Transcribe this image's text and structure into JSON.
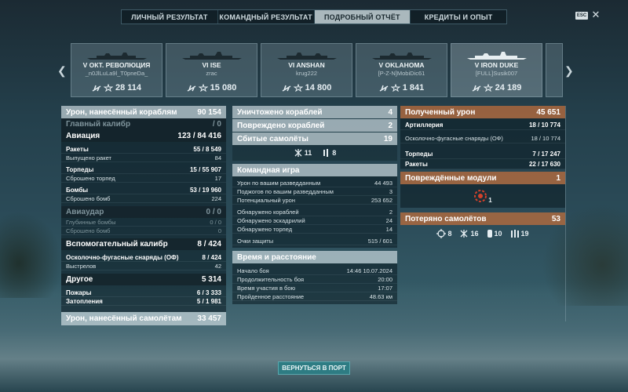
{
  "tabs": [
    "ЛИЧНЫЙ РЕЗУЛЬТАТ",
    "КОМАНДНЫЙ РЕЗУЛЬТАТ",
    "ПОДРОБНЫЙ ОТЧЁТ",
    "КРЕДИТЫ И ОПЫТ"
  ],
  "active_tab": "ПОДРОБНЫЙ ОТЧЁТ",
  "esc_label": "ESC",
  "close_glyph": "✕",
  "arrows": {
    "left": "❮",
    "right": "❯"
  },
  "ships": [
    {
      "name": "V  ОКТ. РЕВОЛЮЦИЯ",
      "player": "_n0JlLuLa9l_T0pneDa_",
      "frags": "",
      "damage": "28 114"
    },
    {
      "name": "VI  ISE",
      "player": "zrac",
      "frags": "",
      "damage": "15 080"
    },
    {
      "name": "VI  ANSHAN",
      "player": "krug222",
      "frags": "",
      "damage": "14 800"
    },
    {
      "name": "V  OKLAHOMA",
      "player": "[P-Z-N]MobiDic61",
      "frags": "",
      "damage": "1 841"
    },
    {
      "name": "V  IRON DUKE",
      "player": "[FULL]Susik007",
      "frags": "",
      "damage": "24 189"
    }
  ],
  "left": {
    "damage_ships": {
      "label": "Урон, нанесённый кораблям",
      "value": "90 154"
    },
    "main_caliber": {
      "label": "Главный калибр",
      "value": "/ 0"
    },
    "aviation": {
      "label": "Авиация",
      "value": "123 / 84 416"
    },
    "rockets": {
      "label": "Ракеты",
      "value": "55 / 8 549"
    },
    "rockets_fired": {
      "label": "Выпущено ракет",
      "value": "84"
    },
    "torpedoes": {
      "label": "Торпеды",
      "value": "15 / 55 907"
    },
    "torpedoes_dropped": {
      "label": "Сброшено торпед",
      "value": "17"
    },
    "bombs": {
      "label": "Бомбы",
      "value": "53 / 19 960"
    },
    "bombs_dropped": {
      "label": "Сброшено бомб",
      "value": "224"
    },
    "airstrike": {
      "label": "Авиаудар",
      "value": "0 / 0"
    },
    "depth_bombs": {
      "label": "Глубинные бомбы",
      "value": "0 / 0"
    },
    "depth_dropped": {
      "label": "Сброшено бомб",
      "value": "0"
    },
    "secondary": {
      "label": "Вспомогательный калибр",
      "value": "8 / 424"
    },
    "he_shells": {
      "label": "Осколочно-фугасные снаряды (ОФ)",
      "value": "8 / 424"
    },
    "shots": {
      "label": "Выстрелов",
      "value": "42"
    },
    "other": {
      "label": "Другое",
      "value": "5 314"
    },
    "fires": {
      "label": "Пожары",
      "value": "6 / 3 333"
    },
    "floods": {
      "label": "Затопления",
      "value": "5 / 1 981"
    },
    "damage_planes": {
      "label": "Урон, нанесённый самолётам",
      "value": "33 457"
    }
  },
  "middle": {
    "destroyed": {
      "label": "Уничтожено кораблей",
      "value": "4"
    },
    "damaged": {
      "label": "Повреждено кораблей",
      "value": "2"
    },
    "planes_shot": {
      "label": "Сбитые самолёты",
      "value": "19"
    },
    "planes_icons": {
      "a": "11",
      "b": "8"
    },
    "teamplay": {
      "label": "Командная игра"
    },
    "spotting_dmg": {
      "label": "Урон по вашим разведданным",
      "value": "44 493"
    },
    "fires_spot": {
      "label": "Поджогов по вашим разведданным",
      "value": "3"
    },
    "potential": {
      "label": "Потенциальный урон",
      "value": "253 652"
    },
    "ships_spotted": {
      "label": "Обнаружено кораблей",
      "value": "2"
    },
    "squads_spotted": {
      "label": "Обнаружено эскадрилий",
      "value": "24"
    },
    "torps_spotted": {
      "label": "Обнаружено торпед",
      "value": "14"
    },
    "defense": {
      "label": "Очки защиты",
      "value": "515 / 601"
    },
    "time": {
      "label": "Время и расстояние"
    },
    "start": {
      "label": "Начало боя",
      "value": "14:46  10.07.2024"
    },
    "duration": {
      "label": "Продолжительность боя",
      "value": "20:00"
    },
    "participation": {
      "label": "Время участия в бою",
      "value": "17:07"
    },
    "distance": {
      "label": "Пройденное расстояние",
      "value": "48.63 км"
    }
  },
  "right": {
    "received": {
      "label": "Полученный урон",
      "value": "45 651"
    },
    "artillery": {
      "label": "Артиллерия",
      "value": "18 / 10 774"
    },
    "he": {
      "label": "Осколочно-фугасные снаряды (ОФ)",
      "value": "18 / 10 774"
    },
    "torpedoes": {
      "label": "Торпеды",
      "value": "7 / 17 247"
    },
    "rockets": {
      "label": "Ракеты",
      "value": "22 / 17 630"
    },
    "modules": {
      "label": "Повреждённые модули",
      "value": "1"
    },
    "module_count": "1",
    "planes_lost": {
      "label": "Потеряно самолётов",
      "value": "53"
    },
    "plane_icons": {
      "a": "8",
      "b": "16",
      "c": "10",
      "d": "19"
    }
  },
  "return_button": "ВЕРНУТЬСЯ В ПОРТ"
}
